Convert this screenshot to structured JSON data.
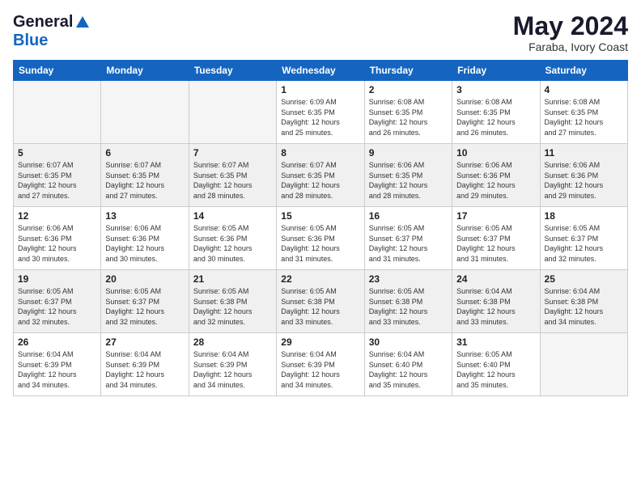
{
  "logo": {
    "line1": "General",
    "line2": "Blue"
  },
  "title": {
    "month_year": "May 2024",
    "location": "Faraba, Ivory Coast"
  },
  "days_of_week": [
    "Sunday",
    "Monday",
    "Tuesday",
    "Wednesday",
    "Thursday",
    "Friday",
    "Saturday"
  ],
  "weeks": [
    {
      "shaded": false,
      "days": [
        {
          "num": "",
          "info": ""
        },
        {
          "num": "",
          "info": ""
        },
        {
          "num": "",
          "info": ""
        },
        {
          "num": "1",
          "info": "Sunrise: 6:09 AM\nSunset: 6:35 PM\nDaylight: 12 hours\nand 25 minutes."
        },
        {
          "num": "2",
          "info": "Sunrise: 6:08 AM\nSunset: 6:35 PM\nDaylight: 12 hours\nand 26 minutes."
        },
        {
          "num": "3",
          "info": "Sunrise: 6:08 AM\nSunset: 6:35 PM\nDaylight: 12 hours\nand 26 minutes."
        },
        {
          "num": "4",
          "info": "Sunrise: 6:08 AM\nSunset: 6:35 PM\nDaylight: 12 hours\nand 27 minutes."
        }
      ]
    },
    {
      "shaded": true,
      "days": [
        {
          "num": "5",
          "info": "Sunrise: 6:07 AM\nSunset: 6:35 PM\nDaylight: 12 hours\nand 27 minutes."
        },
        {
          "num": "6",
          "info": "Sunrise: 6:07 AM\nSunset: 6:35 PM\nDaylight: 12 hours\nand 27 minutes."
        },
        {
          "num": "7",
          "info": "Sunrise: 6:07 AM\nSunset: 6:35 PM\nDaylight: 12 hours\nand 28 minutes."
        },
        {
          "num": "8",
          "info": "Sunrise: 6:07 AM\nSunset: 6:35 PM\nDaylight: 12 hours\nand 28 minutes."
        },
        {
          "num": "9",
          "info": "Sunrise: 6:06 AM\nSunset: 6:35 PM\nDaylight: 12 hours\nand 28 minutes."
        },
        {
          "num": "10",
          "info": "Sunrise: 6:06 AM\nSunset: 6:36 PM\nDaylight: 12 hours\nand 29 minutes."
        },
        {
          "num": "11",
          "info": "Sunrise: 6:06 AM\nSunset: 6:36 PM\nDaylight: 12 hours\nand 29 minutes."
        }
      ]
    },
    {
      "shaded": false,
      "days": [
        {
          "num": "12",
          "info": "Sunrise: 6:06 AM\nSunset: 6:36 PM\nDaylight: 12 hours\nand 30 minutes."
        },
        {
          "num": "13",
          "info": "Sunrise: 6:06 AM\nSunset: 6:36 PM\nDaylight: 12 hours\nand 30 minutes."
        },
        {
          "num": "14",
          "info": "Sunrise: 6:05 AM\nSunset: 6:36 PM\nDaylight: 12 hours\nand 30 minutes."
        },
        {
          "num": "15",
          "info": "Sunrise: 6:05 AM\nSunset: 6:36 PM\nDaylight: 12 hours\nand 31 minutes."
        },
        {
          "num": "16",
          "info": "Sunrise: 6:05 AM\nSunset: 6:37 PM\nDaylight: 12 hours\nand 31 minutes."
        },
        {
          "num": "17",
          "info": "Sunrise: 6:05 AM\nSunset: 6:37 PM\nDaylight: 12 hours\nand 31 minutes."
        },
        {
          "num": "18",
          "info": "Sunrise: 6:05 AM\nSunset: 6:37 PM\nDaylight: 12 hours\nand 32 minutes."
        }
      ]
    },
    {
      "shaded": true,
      "days": [
        {
          "num": "19",
          "info": "Sunrise: 6:05 AM\nSunset: 6:37 PM\nDaylight: 12 hours\nand 32 minutes."
        },
        {
          "num": "20",
          "info": "Sunrise: 6:05 AM\nSunset: 6:37 PM\nDaylight: 12 hours\nand 32 minutes."
        },
        {
          "num": "21",
          "info": "Sunrise: 6:05 AM\nSunset: 6:38 PM\nDaylight: 12 hours\nand 32 minutes."
        },
        {
          "num": "22",
          "info": "Sunrise: 6:05 AM\nSunset: 6:38 PM\nDaylight: 12 hours\nand 33 minutes."
        },
        {
          "num": "23",
          "info": "Sunrise: 6:05 AM\nSunset: 6:38 PM\nDaylight: 12 hours\nand 33 minutes."
        },
        {
          "num": "24",
          "info": "Sunrise: 6:04 AM\nSunset: 6:38 PM\nDaylight: 12 hours\nand 33 minutes."
        },
        {
          "num": "25",
          "info": "Sunrise: 6:04 AM\nSunset: 6:38 PM\nDaylight: 12 hours\nand 34 minutes."
        }
      ]
    },
    {
      "shaded": false,
      "days": [
        {
          "num": "26",
          "info": "Sunrise: 6:04 AM\nSunset: 6:39 PM\nDaylight: 12 hours\nand 34 minutes."
        },
        {
          "num": "27",
          "info": "Sunrise: 6:04 AM\nSunset: 6:39 PM\nDaylight: 12 hours\nand 34 minutes."
        },
        {
          "num": "28",
          "info": "Sunrise: 6:04 AM\nSunset: 6:39 PM\nDaylight: 12 hours\nand 34 minutes."
        },
        {
          "num": "29",
          "info": "Sunrise: 6:04 AM\nSunset: 6:39 PM\nDaylight: 12 hours\nand 34 minutes."
        },
        {
          "num": "30",
          "info": "Sunrise: 6:04 AM\nSunset: 6:40 PM\nDaylight: 12 hours\nand 35 minutes."
        },
        {
          "num": "31",
          "info": "Sunrise: 6:05 AM\nSunset: 6:40 PM\nDaylight: 12 hours\nand 35 minutes."
        },
        {
          "num": "",
          "info": ""
        }
      ]
    }
  ]
}
